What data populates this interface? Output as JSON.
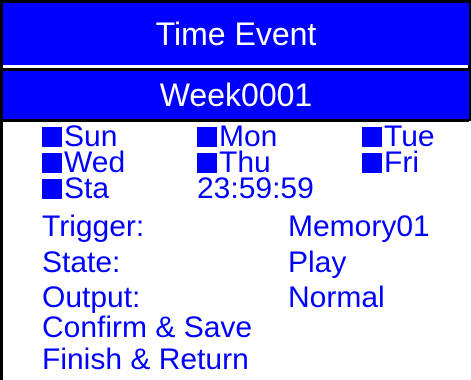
{
  "title": "Time Event",
  "subtitle": "Week0001",
  "days": [
    {
      "label": "Sun",
      "checked": true
    },
    {
      "label": "Mon",
      "checked": true
    },
    {
      "label": "Tue",
      "checked": true
    },
    {
      "label": "Wed",
      "checked": true
    },
    {
      "label": "Thu",
      "checked": true
    },
    {
      "label": "Fri",
      "checked": true
    },
    {
      "label": "Sta",
      "checked": true
    }
  ],
  "time": "23:59:59",
  "trigger": {
    "label": "Trigger:",
    "value": "Memory01"
  },
  "state": {
    "label": "State:",
    "value": "Play"
  },
  "output": {
    "label": "Output:",
    "value": "Normal"
  },
  "actions": {
    "confirm": "Confirm & Save",
    "finish": "Finish & Return"
  },
  "colors": {
    "accent": "#0000ff",
    "text_on_accent": "#ffffff",
    "border": "#000000"
  }
}
